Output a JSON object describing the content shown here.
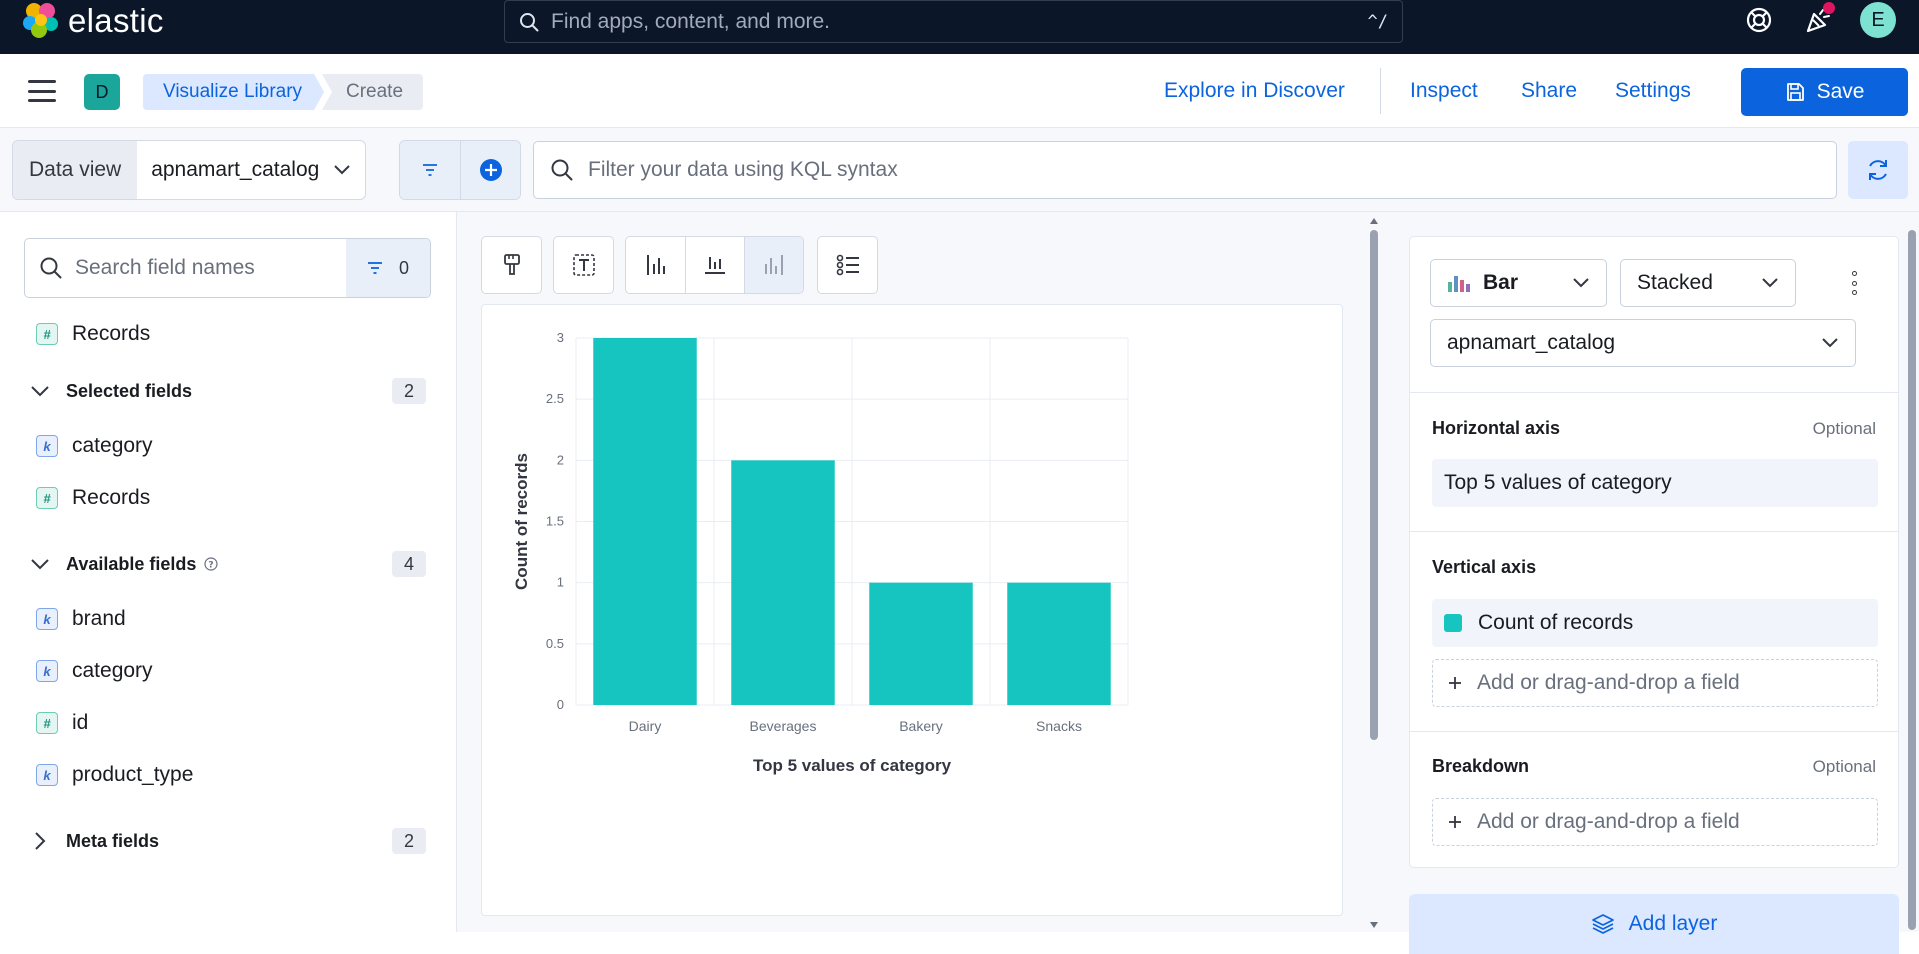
{
  "header": {
    "brand": "elastic",
    "search_placeholder": "Find apps, content, and more.",
    "search_shortcut": "^/",
    "user_initial": "E"
  },
  "nav": {
    "space_initial": "D",
    "breadcrumbs": [
      "Visualize Library",
      "Create"
    ],
    "actions": {
      "explore": "Explore in Discover",
      "inspect": "Inspect",
      "share": "Share",
      "settings": "Settings",
      "save": "Save"
    }
  },
  "query": {
    "data_view_label": "Data view",
    "data_view_value": "apnamart_catalog",
    "kql_placeholder": "Filter your data using KQL syntax"
  },
  "fields": {
    "search_placeholder": "Search field names",
    "filter_count": "0",
    "records_label": "Records",
    "selected": {
      "title": "Selected fields",
      "count": "2",
      "items": [
        {
          "name": "category",
          "type": "k"
        },
        {
          "name": "Records",
          "type": "#"
        }
      ]
    },
    "available": {
      "title": "Available fields",
      "count": "4",
      "items": [
        {
          "name": "brand",
          "type": "k"
        },
        {
          "name": "category",
          "type": "k"
        },
        {
          "name": "id",
          "type": "#"
        },
        {
          "name": "product_type",
          "type": "k"
        }
      ]
    },
    "meta": {
      "title": "Meta fields",
      "count": "2"
    }
  },
  "config": {
    "chart_type": "Bar",
    "stacking": "Stacked",
    "data_view": "apnamart_catalog",
    "horizontal_axis": {
      "label": "Horizontal axis",
      "optional": "Optional",
      "value": "Top 5 values of category"
    },
    "vertical_axis": {
      "label": "Vertical axis",
      "value": "Count of records"
    },
    "breakdown": {
      "label": "Breakdown",
      "optional": "Optional"
    },
    "add_field": "Add or drag-and-drop a field",
    "add_layer": "Add layer"
  },
  "colors": {
    "header_bg": "#0b1628",
    "accent": "#0b64dd",
    "bar": "#16c5c0"
  },
  "chart_data": {
    "type": "bar",
    "categories": [
      "Dairy",
      "Beverages",
      "Bakery",
      "Snacks"
    ],
    "values": [
      3,
      2,
      1,
      1
    ],
    "yticks": [
      "0",
      "0.5",
      "1",
      "1.5",
      "2",
      "2.5",
      "3"
    ],
    "xlabel": "Top 5 values of category",
    "ylabel": "Count of records",
    "ylim": [
      0,
      3
    ],
    "grid": true,
    "color": "#16c5c0"
  }
}
